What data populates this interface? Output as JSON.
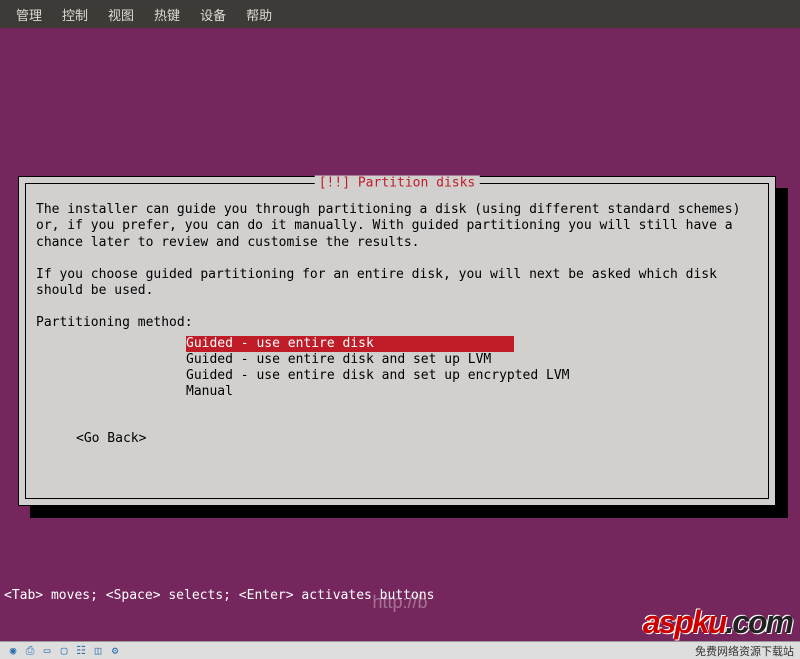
{
  "menubar": {
    "items": [
      "管理",
      "控制",
      "视图",
      "热键",
      "设备",
      "帮助"
    ]
  },
  "dialog": {
    "title": "[!!] Partition disks",
    "para1": "The installer can guide you through partitioning a disk (using different standard schemes) or, if you prefer, you can do it manually. With guided partitioning you will still have a chance later to review and customise the results.",
    "para2": "If you choose guided partitioning for an entire disk, you will next be asked which disk should be used.",
    "method_label": "Partitioning method:",
    "options": [
      "Guided - use entire disk",
      "Guided - use entire disk and set up LVM",
      "Guided - use entire disk and set up encrypted LVM",
      "Manual"
    ],
    "go_back": "<Go Back>"
  },
  "help_line": "<Tab> moves; <Space> selects; <Enter> activates buttons",
  "watermark": {
    "logo_a": "aspku",
    "logo_b": ".com",
    "url": "http://b",
    "tag": "免费网络资源下载站"
  },
  "tray": {
    "icons": [
      "disc-icon",
      "usb-icon",
      "folder-icon",
      "display-icon",
      "network-icon",
      "mouse-icon",
      "settings-icon"
    ]
  }
}
